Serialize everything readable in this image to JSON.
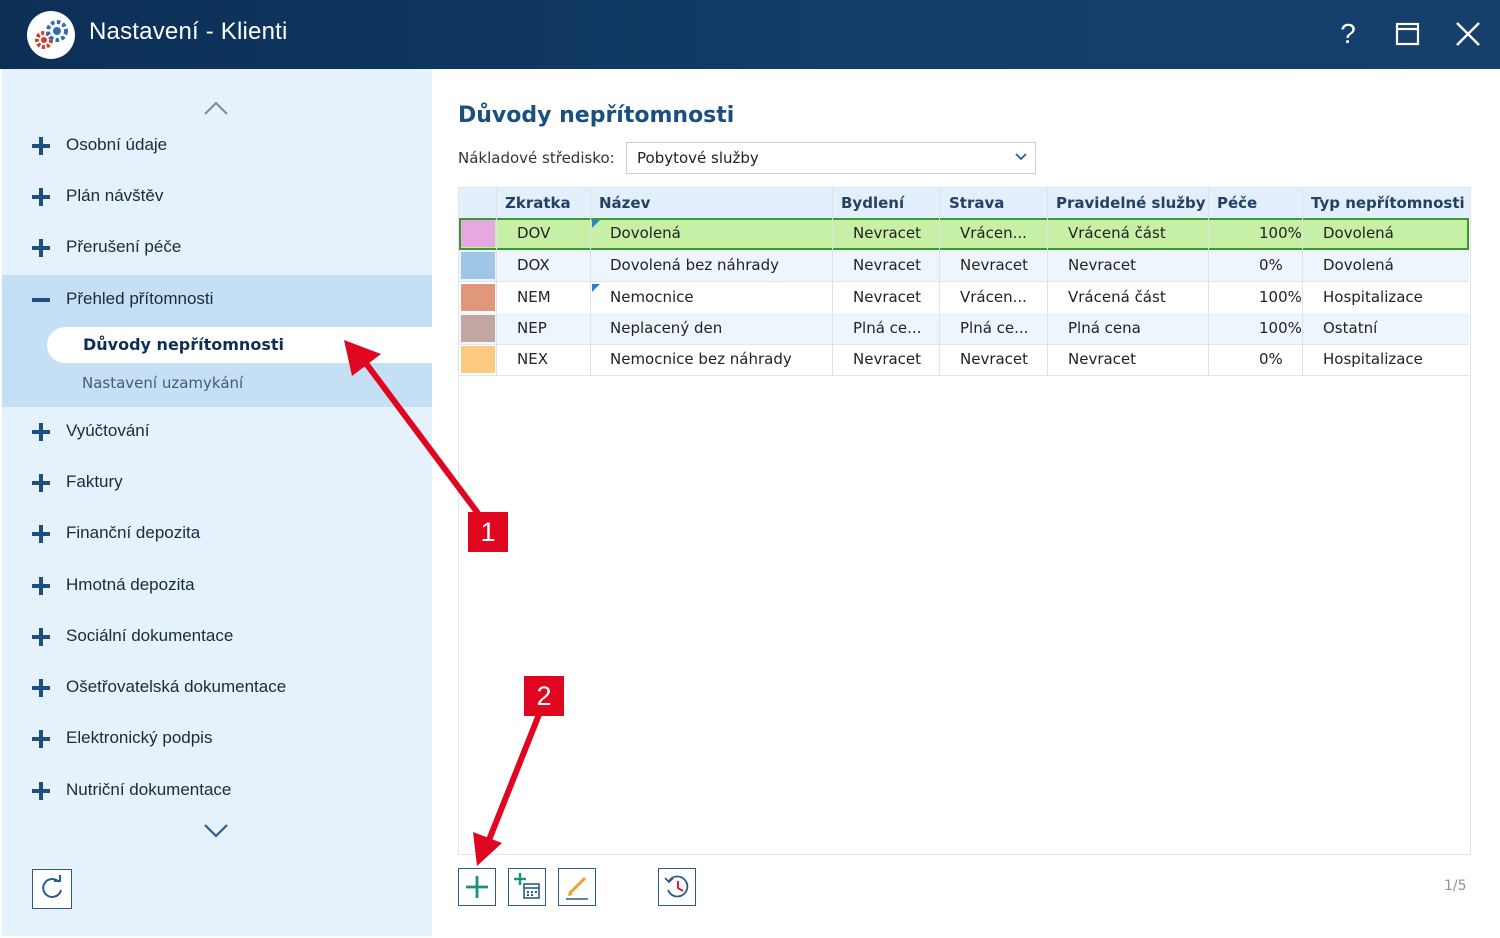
{
  "window": {
    "title": "Nastavení - Klienti",
    "help_label": "?"
  },
  "sidebar": {
    "items": [
      {
        "label": "Osobní údaje"
      },
      {
        "label": "Plán návštěv"
      },
      {
        "label": "Přerušení péče"
      },
      {
        "label": "Přehled přítomnosti",
        "expanded": true
      },
      {
        "label": "Vyúčtování"
      },
      {
        "label": "Faktury"
      },
      {
        "label": "Finanční depozita"
      },
      {
        "label": "Hmotná depozita"
      },
      {
        "label": "Sociální dokumentace"
      },
      {
        "label": "Ošetřovatelská dokumentace"
      },
      {
        "label": "Elektronický podpis"
      },
      {
        "label": "Nutriční dokumentace"
      }
    ],
    "subitems": [
      {
        "label": "Důvody nepřítomnosti",
        "active": true
      },
      {
        "label": "Nastavení uzamykání"
      }
    ]
  },
  "main": {
    "title": "Důvody nepřítomnosti",
    "filter_label": "Nákladové středisko:",
    "filter_value": "Pobytové služby",
    "columns": [
      "Zkratka",
      "Název",
      "Bydlení",
      "Strava",
      "Pravidelné služby",
      "Péče",
      "Typ nepřítomnosti"
    ],
    "rows": [
      {
        "color": "#e7a7e0",
        "code": "DOV",
        "name": "Dovolená",
        "housing": "Nevracet",
        "food": "Vrácen...",
        "services": "Vrácená část",
        "care": "100%",
        "type": "Dovolená",
        "selected": true
      },
      {
        "color": "#9fc6e6",
        "code": "DOX",
        "name": "Dovolená bez náhrady",
        "housing": "Nevracet",
        "food": "Nevracet",
        "services": "Nevracet",
        "care": "0%",
        "type": "Dovolená"
      },
      {
        "color": "#e0977c",
        "code": "NEM",
        "name": "Nemocnice",
        "housing": "Nevracet",
        "food": "Vrácen...",
        "services": "Vrácená část",
        "care": "100%",
        "type": "Hospitalizace"
      },
      {
        "color": "#c1a6a2",
        "code": "NEP",
        "name": "Neplacený den",
        "housing": "Plná ce...",
        "food": "Plná ce...",
        "services": "Plná cena",
        "care": "100%",
        "type": "Ostatní"
      },
      {
        "color": "#fccb80",
        "code": "NEX",
        "name": "Nemocnice bez náhrady",
        "housing": "Nevracet",
        "food": "Nevracet",
        "services": "Nevracet",
        "care": "0%",
        "type": "Hospitalizace"
      }
    ],
    "pager": "1/5"
  },
  "callouts": [
    "1",
    "2"
  ],
  "colors": {
    "titlebar": "#123d6b",
    "accent": "#1b4f82",
    "selected_row": "#c6f0a6",
    "callout": "#e0061f"
  }
}
